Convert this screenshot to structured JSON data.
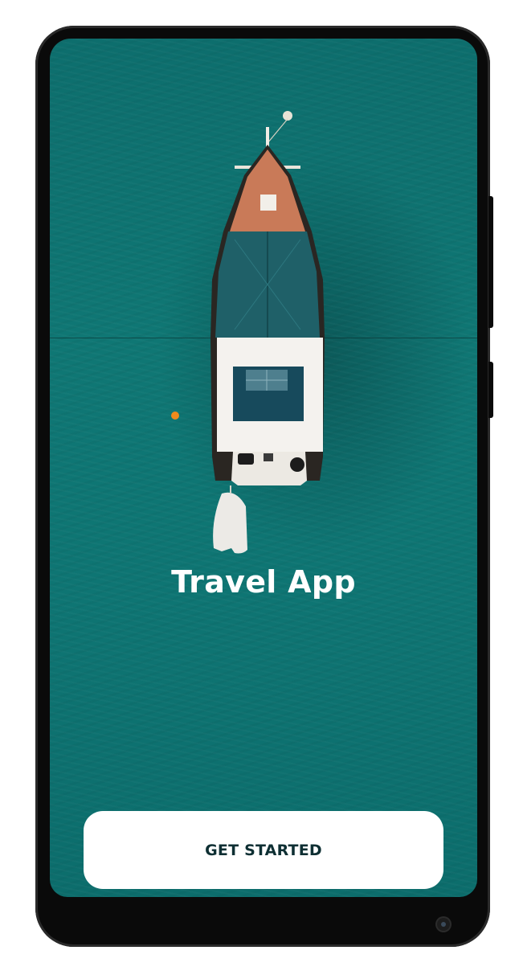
{
  "app": {
    "title": "Travel App"
  },
  "actions": {
    "get_started_label": "GET STARTED"
  },
  "theme": {
    "sea": "#0f7774",
    "button_bg": "#ffffff",
    "button_text": "#0e2f33",
    "buoy": "#f08a1c"
  }
}
